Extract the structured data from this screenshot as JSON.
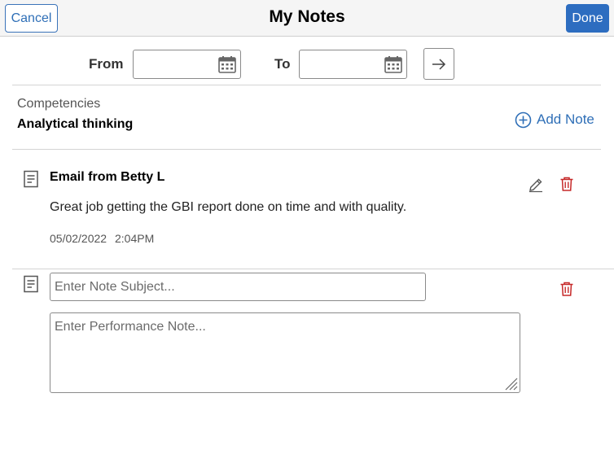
{
  "header": {
    "title": "My Notes",
    "cancel_label": "Cancel",
    "done_label": "Done"
  },
  "filters": {
    "from_label": "From",
    "from_value": "",
    "to_label": "To",
    "to_value": ""
  },
  "competency": {
    "label": "Competencies",
    "value": "Analytical thinking"
  },
  "add_note_label": "Add Note",
  "notes": [
    {
      "subject": "Email from Betty L",
      "body": "Great job getting the GBI report done on time and with quality.",
      "date": "05/02/2022",
      "time": "2:04PM"
    }
  ],
  "new_note": {
    "subject_placeholder": "Enter Note Subject...",
    "subject_value": "",
    "body_placeholder": "Enter Performance Note...",
    "body_value": ""
  },
  "icons": {
    "calendar": "calendar-icon",
    "go": "arrow-right-icon",
    "add": "plus-circle-icon",
    "note": "note-document-icon",
    "edit": "pencil-icon",
    "delete": "trash-icon"
  },
  "colors": {
    "accent": "#2d6dc0",
    "delete": "#c62828",
    "header_bg": "#f5f5f5"
  }
}
